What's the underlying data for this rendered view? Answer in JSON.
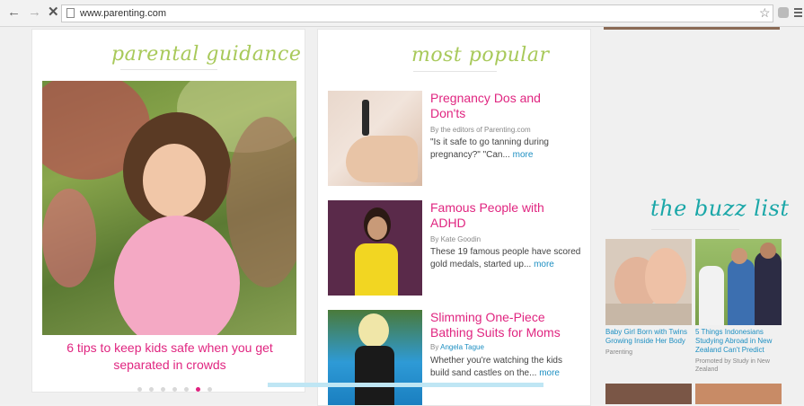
{
  "browser": {
    "url": "www.parenting.com",
    "back_icon": "←",
    "forward_icon": "→",
    "stop_icon": "✕",
    "star_icon": "☆"
  },
  "guidance": {
    "title": "parental guidance",
    "caption": "6 tips to keep kids safe when you get separated in crowds"
  },
  "popular": {
    "title": "most popular",
    "items": [
      {
        "title": "Pregnancy Dos and Don'ts",
        "byline": "By the editors of Parenting.com",
        "description": "\"Is it safe to go tanning during pregnancy?\" \"Can...",
        "more": "more"
      },
      {
        "title": "Famous People with ADHD",
        "byline_prefix": "By",
        "author": "Kate Goodin",
        "description": "These 19 famous people have scored gold medals, started up...",
        "more": "more"
      },
      {
        "title": "Slimming One-Piece Bathing Suits for Moms",
        "byline_prefix": "By",
        "author": "Angela Tague",
        "description": "Whether you're watching the kids build sand castles on the...",
        "more": "more"
      }
    ]
  },
  "buzz": {
    "title": "the buzz list",
    "items": [
      {
        "title": "Baby Girl Born with Twins Growing Inside Her Body",
        "source": "Parenting"
      },
      {
        "title": "5 Things Indonesians Studying Abroad in New Zealand Can't Predict",
        "source": "Promoted by Study in New Zealand"
      }
    ]
  },
  "colors": {
    "accent_pink": "#e02580",
    "link_blue": "#1d8fc2",
    "title_green": "#a8c95a",
    "title_teal": "#1aa7a8"
  }
}
